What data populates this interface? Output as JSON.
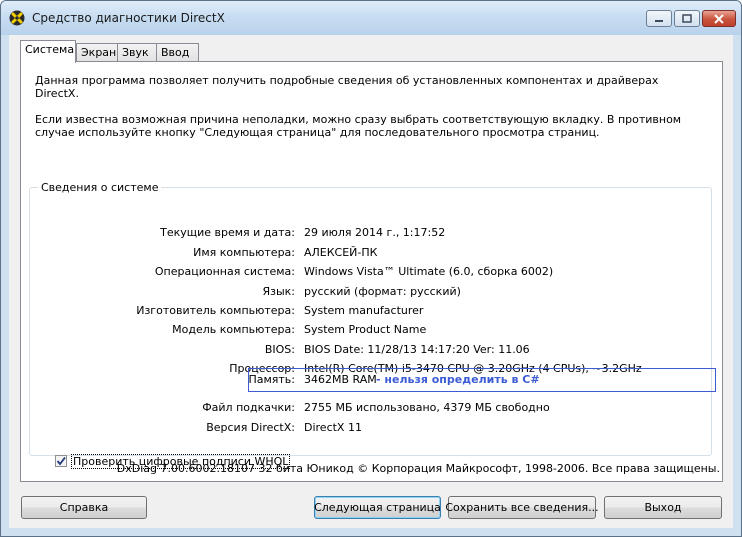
{
  "window": {
    "title": "Средство диагностики DirectX",
    "colors": {
      "close_button": "#c9533d",
      "annotation": "#3c5bd4"
    }
  },
  "tabs": [
    {
      "label": "Система",
      "active": true
    },
    {
      "label": "Экран",
      "active": false
    },
    {
      "label": "Звук",
      "active": false
    },
    {
      "label": "Ввод",
      "active": false
    }
  ],
  "intro": {
    "line1": "Данная программа позволяет получить подробные сведения об установленных компонентах и драйверах DirectX.",
    "line2": "Если известна возможная причина неполадки, можно сразу выбрать соответствующую вкладку. В противном случае используйте кнопку \"Следующая страница\" для последовательного просмотра страниц."
  },
  "system_info": {
    "group_title": "Сведения о системе",
    "rows": [
      {
        "label": "Текущие время и дата:",
        "value": "29 июля 2014 г., 1:17:52"
      },
      {
        "label": "Имя компьютера:",
        "value": "АЛЕКСЕЙ-ПК"
      },
      {
        "label": "Операционная система:",
        "value": "Windows Vista™ Ultimate (6.0, сборка 6002)"
      },
      {
        "label": "Язык:",
        "value": "русский (формат: русский)"
      },
      {
        "label": "Изготовитель компьютера:",
        "value": "System manufacturer"
      },
      {
        "label": "Модель компьютера:",
        "value": "System Product Name"
      },
      {
        "label": "BIOS:",
        "value": "BIOS Date: 11/28/13 14:17:20 Ver: 11.06"
      },
      {
        "label": "Процессор:",
        "value": "Intel(R) Core(TM) i5-3470 CPU @ 3.20GHz (4 CPUs), ~3.2GHz"
      },
      {
        "label": "Память:",
        "value": "3462MB RAM"
      },
      {
        "label": "Файл подкачки:",
        "value": "2755 МБ использовано, 4379 МБ свободно"
      },
      {
        "label": "Версия DirectX:",
        "value": "DirectX 11"
      }
    ],
    "memory_note": "- нельзя определить в С#"
  },
  "whql_checkbox": {
    "label": "Проверить цифровые подписи WHQL",
    "checked": true
  },
  "footer": "DxDiag 7.00.6002.18107 32 бита Юникод  © Корпорация Майкрософт, 1998-2006.  Все права защищены.",
  "buttons": {
    "help": "Справка",
    "next": "Следующая страница",
    "save": "Сохранить все сведения...",
    "exit": "Выход"
  }
}
